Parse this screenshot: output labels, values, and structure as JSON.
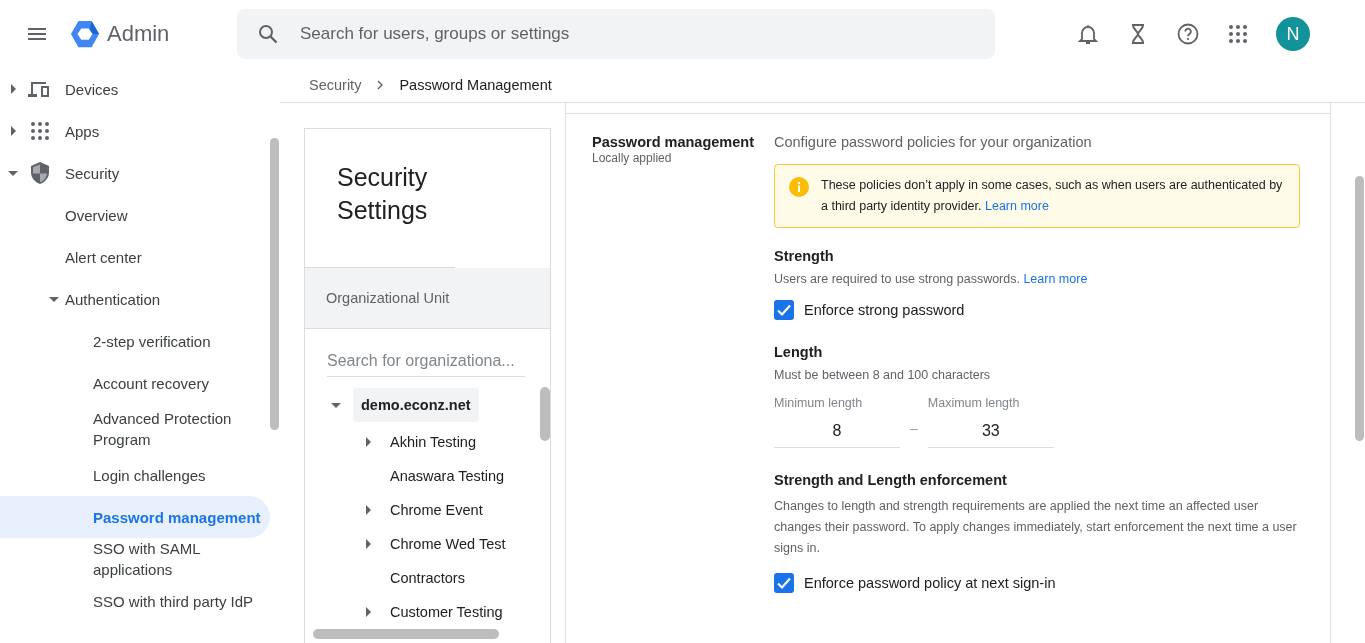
{
  "app": {
    "title": "Admin",
    "search_placeholder": "Search for users, groups or settings",
    "avatar_initial": "N"
  },
  "sidebar": {
    "items": [
      {
        "label": "Devices",
        "kind": "branch",
        "expanded": false,
        "selected": false
      },
      {
        "label": "Apps",
        "kind": "branch",
        "expanded": false,
        "selected": false
      },
      {
        "label": "Security",
        "kind": "branch",
        "expanded": true,
        "selected": false,
        "children": [
          {
            "label": "Overview",
            "kind": "leaf",
            "selected": false
          },
          {
            "label": "Alert center",
            "kind": "leaf",
            "selected": false
          },
          {
            "label": "Authentication",
            "kind": "branch",
            "expanded": true,
            "selected": false,
            "children": [
              {
                "label": "2-step verification",
                "kind": "leaf",
                "selected": false
              },
              {
                "label": "Account recovery",
                "kind": "leaf",
                "selected": false
              },
              {
                "label": "Advanced Protection Program",
                "kind": "leaf",
                "selected": false
              },
              {
                "label": "Login challenges",
                "kind": "leaf",
                "selected": false
              },
              {
                "label": "Password management",
                "kind": "leaf",
                "selected": true
              },
              {
                "label": "SSO with SAML applications",
                "kind": "leaf",
                "selected": false
              },
              {
                "label": "SSO with third party IdP",
                "kind": "leaf",
                "selected": false
              }
            ]
          }
        ]
      }
    ]
  },
  "breadcrumb": [
    {
      "label": "Security"
    },
    {
      "label": "Password Management"
    }
  ],
  "settings_card": {
    "title": "Security Settings",
    "section_label": "Organizational Unit",
    "search_placeholder": "Search for organizationa..."
  },
  "org_tree": {
    "items": [
      {
        "label": "demo.econz.net",
        "kind": "branch",
        "expanded": true,
        "selected": true,
        "children": [
          {
            "label": "Akhin Testing",
            "kind": "branch",
            "expanded": false,
            "selected": false
          },
          {
            "label": "Anaswara Testing",
            "kind": "leaf",
            "selected": false
          },
          {
            "label": "Chrome Event",
            "kind": "branch",
            "expanded": false,
            "selected": false
          },
          {
            "label": "Chrome Wed Test",
            "kind": "branch",
            "expanded": false,
            "selected": false
          },
          {
            "label": "Contractors",
            "kind": "leaf",
            "selected": false
          },
          {
            "label": "Customer Testing",
            "kind": "branch",
            "expanded": false,
            "selected": false
          }
        ]
      }
    ]
  },
  "policy": {
    "title": "Password management",
    "subtitle": "Locally applied",
    "description": "Configure password policies for your organization",
    "notice": {
      "text": "These policies don’t apply in some cases, such as when users are authenticated by a third party identity provider.",
      "link": "Learn more"
    },
    "strength": {
      "title": "Strength",
      "description": "Users are required to use strong passwords.",
      "link": "Learn more",
      "checkbox": {
        "label": "Enforce strong password",
        "checked": true
      }
    },
    "length": {
      "title": "Length",
      "description": "Must be between 8 and 100 characters",
      "min": {
        "label": "Minimum length",
        "value": "8"
      },
      "separator": "–",
      "max": {
        "label": "Maximum length",
        "value": "33"
      }
    },
    "enforcement": {
      "title": "Strength and Length enforcement",
      "description": "Changes to length and strength requirements are applied the next time an affected user changes their password. To apply changes immediately, start enforcement the next time a user signs in.",
      "checkbox": {
        "label": "Enforce password policy at next sign-in",
        "checked": true
      }
    }
  }
}
